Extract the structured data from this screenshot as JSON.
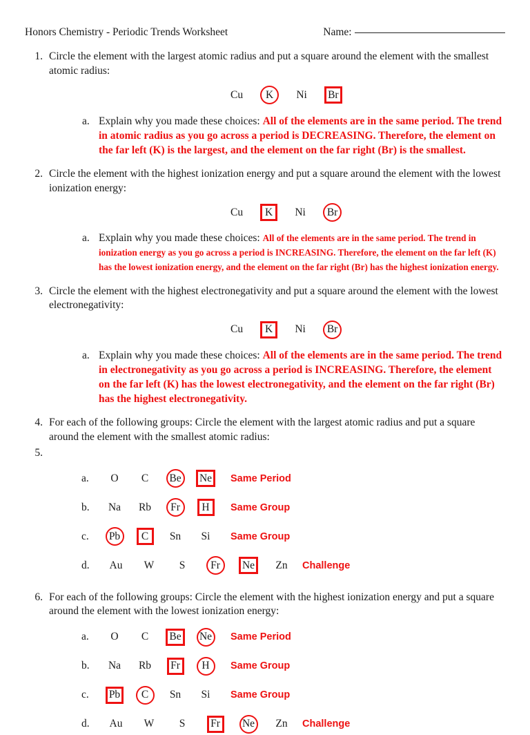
{
  "header": {
    "title": "Honors Chemistry - Periodic Trends Worksheet",
    "name_label": "Name:",
    "name_value": ""
  },
  "colors": {
    "answer_red": "#ee1111",
    "text": "#1a1a1a"
  },
  "questions": [
    {
      "number": "1.",
      "text": "Circle the element with the largest atomic radius and put a square around the element with the smallest atomic radius:",
      "elements": [
        {
          "symbol": "Cu",
          "mark": "none"
        },
        {
          "symbol": "K",
          "mark": "circle"
        },
        {
          "symbol": "Ni",
          "mark": "none"
        },
        {
          "symbol": "Br",
          "mark": "square"
        }
      ],
      "sub": {
        "letter": "a.",
        "prompt": "Explain why you made these choices:",
        "answer": "All of the elements are in the same period.  The trend in atomic radius as you go across a period is DECREASING.  Therefore, the element on the far left (K) is the largest, and the element on the far right (Br) is the smallest."
      }
    },
    {
      "number": "2.",
      "text": "Circle the element with the highest ionization energy and put a square around the element with the lowest ionization energy:",
      "elements": [
        {
          "symbol": "Cu",
          "mark": "none"
        },
        {
          "symbol": "K",
          "mark": "square"
        },
        {
          "symbol": "Ni",
          "mark": "none"
        },
        {
          "symbol": "Br",
          "mark": "circle"
        }
      ],
      "sub": {
        "letter": "a.",
        "prompt": "Explain why you made these choices:",
        "answer": "All of the elements are in the same period.  The trend in ionization energy as you go across a period is INCREASING.  Therefore, the element on the far left (K) has the lowest ionization energy, and the element on the far right (Br) has the highest ionization energy."
      }
    },
    {
      "number": "3.",
      "text": "Circle the element with the highest electronegativity and put a square around the element with the lowest electronegativity:",
      "elements": [
        {
          "symbol": "Cu",
          "mark": "none"
        },
        {
          "symbol": "K",
          "mark": "square"
        },
        {
          "symbol": "Ni",
          "mark": "none"
        },
        {
          "symbol": "Br",
          "mark": "circle"
        }
      ],
      "sub": {
        "letter": "a.",
        "prompt": "Explain why you made these choices:",
        "answer": "All of the elements are in the same period.  The trend in electronegativity as you go across a period is INCREASING.  Therefore, the element on the far left (K) has the lowest electronegativity, and the element on the far right (Br) has the highest electronegativity."
      }
    }
  ],
  "question4": {
    "number": "4.",
    "text": "For each of the following groups: Circle the element with the largest atomic radius and put a square around the element with the smallest atomic radius:",
    "empty_number": "5.",
    "groups": [
      {
        "letter": "a.",
        "elements": [
          {
            "symbol": "O",
            "mark": "none"
          },
          {
            "symbol": "C",
            "mark": "none"
          },
          {
            "symbol": "Be",
            "mark": "circle"
          },
          {
            "symbol": "Ne",
            "mark": "square"
          }
        ],
        "tag": "Same Period"
      },
      {
        "letter": "b.",
        "elements": [
          {
            "symbol": "Na",
            "mark": "none"
          },
          {
            "symbol": "Rb",
            "mark": "none"
          },
          {
            "symbol": "Fr",
            "mark": "circle"
          },
          {
            "symbol": "H",
            "mark": "square"
          }
        ],
        "tag": "Same Group"
      },
      {
        "letter": "c.",
        "elements": [
          {
            "symbol": "Pb",
            "mark": "circle"
          },
          {
            "symbol": "C",
            "mark": "square"
          },
          {
            "symbol": "Sn",
            "mark": "none"
          },
          {
            "symbol": "Si",
            "mark": "none"
          }
        ],
        "tag": "Same Group"
      },
      {
        "letter": "d.",
        "elements": [
          {
            "symbol": "Au",
            "mark": "none"
          },
          {
            "symbol": "W",
            "mark": "none"
          },
          {
            "symbol": "S",
            "mark": "none"
          },
          {
            "symbol": "Fr",
            "mark": "circle"
          },
          {
            "symbol": "Ne",
            "mark": "square"
          },
          {
            "symbol": "Zn",
            "mark": "none"
          }
        ],
        "tag": "Challenge"
      }
    ]
  },
  "question6": {
    "number": "6.",
    "text": "For each of the following groups: Circle the element with the highest ionization energy and put a square around the element with the lowest ionization energy:",
    "groups": [
      {
        "letter": "a.",
        "elements": [
          {
            "symbol": "O",
            "mark": "none"
          },
          {
            "symbol": "C",
            "mark": "none"
          },
          {
            "symbol": "Be",
            "mark": "square"
          },
          {
            "symbol": "Ne",
            "mark": "circle"
          }
        ],
        "tag": "Same Period"
      },
      {
        "letter": "b.",
        "elements": [
          {
            "symbol": "Na",
            "mark": "none"
          },
          {
            "symbol": "Rb",
            "mark": "none"
          },
          {
            "symbol": "Fr",
            "mark": "square"
          },
          {
            "symbol": "H",
            "mark": "circle"
          }
        ],
        "tag": "Same Group"
      },
      {
        "letter": "c.",
        "elements": [
          {
            "symbol": "Pb",
            "mark": "square"
          },
          {
            "symbol": "C",
            "mark": "circle"
          },
          {
            "symbol": "Sn",
            "mark": "none"
          },
          {
            "symbol": "Si",
            "mark": "none"
          }
        ],
        "tag": "Same Group"
      },
      {
        "letter": "d.",
        "elements": [
          {
            "symbol": "Au",
            "mark": "none"
          },
          {
            "symbol": "W",
            "mark": "none"
          },
          {
            "symbol": "S",
            "mark": "none"
          },
          {
            "symbol": "Fr",
            "mark": "square"
          },
          {
            "symbol": "Ne",
            "mark": "circle"
          },
          {
            "symbol": "Zn",
            "mark": "none"
          }
        ],
        "tag": "Challenge"
      }
    ]
  }
}
